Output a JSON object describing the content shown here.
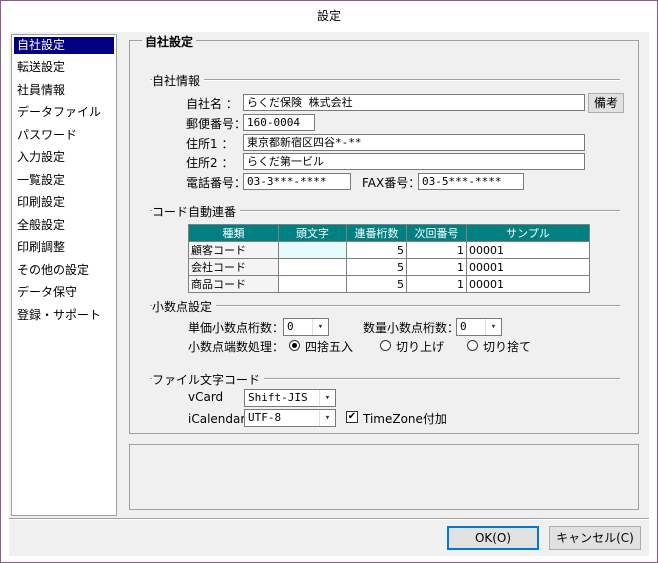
{
  "window": {
    "title": "設定"
  },
  "sidebar": {
    "items": [
      "自社設定",
      "転送設定",
      "社員情報",
      "データファイル",
      "パスワード",
      "入力設定",
      "一覧設定",
      "印刷設定",
      "全般設定",
      "印刷調整",
      "その他の設定",
      "データ保守",
      "登録・サポート"
    ],
    "selected_index": 0
  },
  "main": {
    "title": "自社設定",
    "company": {
      "group_label": "自社情報",
      "name_label": "自社名 ：",
      "name_value": "らくだ保険 株式会社",
      "biko_button": "備考",
      "zip_label": "郵便番号：",
      "zip_value": "160-0004",
      "addr1_label": "住所1 ：",
      "addr1_value": "東京都新宿区四谷*-**",
      "addr2_label": "住所2 ：",
      "addr2_value": "らくだ第一ビル",
      "tel_label": "電話番号：",
      "tel_value": "03-3***-****",
      "fax_label": "FAX番号：",
      "fax_value": "03-5***-****"
    },
    "code": {
      "group_label": "コード自動連番",
      "columns": [
        "種類",
        "頭文字",
        "連番桁数",
        "次回番号",
        "サンプル"
      ],
      "rows": [
        {
          "kind": "顧客コード",
          "prefix": "",
          "digits": "5",
          "next": "1",
          "sample": "00001"
        },
        {
          "kind": "会社コード",
          "prefix": "",
          "digits": "5",
          "next": "1",
          "sample": "00001"
        },
        {
          "kind": "商品コード",
          "prefix": "",
          "digits": "5",
          "next": "1",
          "sample": "00001"
        }
      ]
    },
    "decimal": {
      "group_label": "小数点設定",
      "unit_label": "単価小数点桁数：",
      "unit_value": "0",
      "qty_label": "数量小数点桁数：",
      "qty_value": "0",
      "round_label": "小数点端数処理：",
      "options": [
        "四捨五入",
        "切り上げ",
        "切り捨て"
      ],
      "selected_option": 0
    },
    "charset": {
      "group_label": "ファイル文字コード",
      "vcard_label": "vCard",
      "vcard_value": "Shift-JIS",
      "ical_label": "iCalendar：",
      "ical_value": "UTF-8",
      "timezone_label": "TimeZone付加",
      "timezone_checked": true
    }
  },
  "footer": {
    "ok_label": "OK(O)",
    "cancel_label": "キャンセル(C)"
  }
}
